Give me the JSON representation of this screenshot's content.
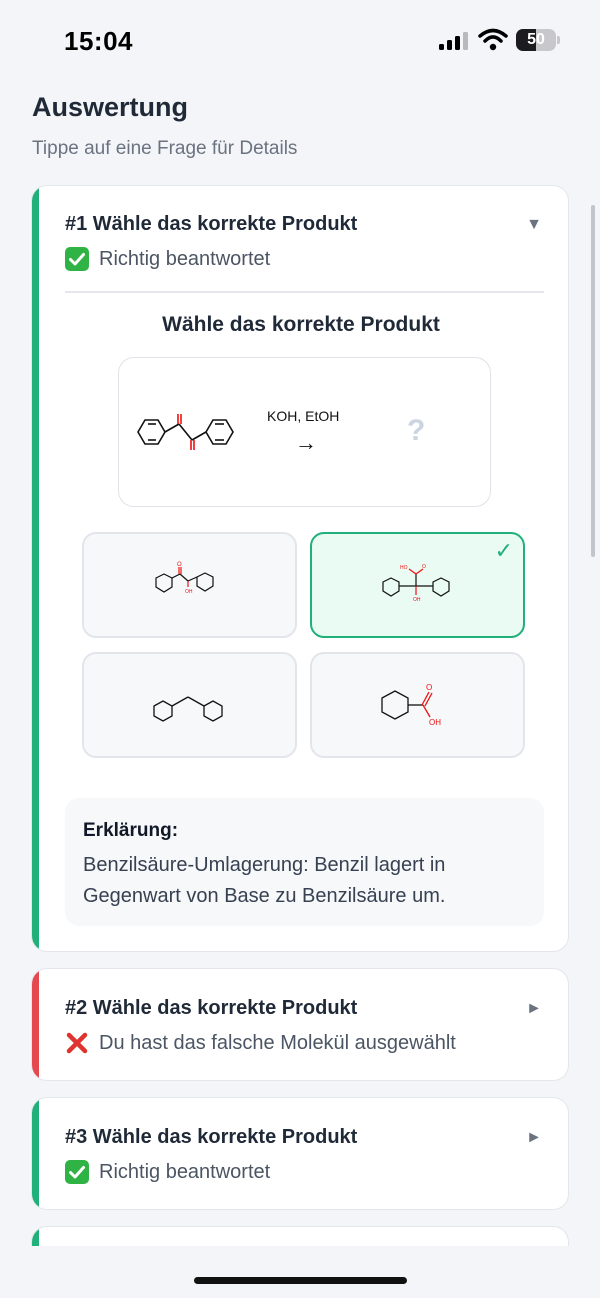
{
  "status_bar": {
    "time": "15:04",
    "battery": "50",
    "battery_level": 0.5
  },
  "header": {
    "title": "Auswertung",
    "subtitle": "Tippe auf eine Frage für Details"
  },
  "colors": {
    "correct": "#20b07a",
    "wrong": "#e5484d"
  },
  "questions": [
    {
      "title": "#1 Wähle das korrekte Produkt",
      "status": "Richtig beantwortet",
      "status_icon": "check-mark-icon",
      "toggle": "▼",
      "expanded": true,
      "detail": {
        "heading": "Wähle das korrekte Produkt",
        "reagent": "KOH, EtOH",
        "arrow": "→",
        "unknown": "?",
        "options": [
          {
            "molecule": "benzoin-like",
            "labels": [
              "O",
              "OH"
            ],
            "selected_correct": false
          },
          {
            "molecule": "benzilic-acid",
            "labels": [
              "HO",
              "O",
              "OH"
            ],
            "selected_correct": true
          },
          {
            "molecule": "diphenylmethane",
            "labels": [],
            "selected_correct": false
          },
          {
            "molecule": "benzoic-acid",
            "labels": [
              "O",
              "OH"
            ],
            "selected_correct": false
          }
        ],
        "explanation_label": "Erklärung:",
        "explanation": "Benzilsäure-Umlagerung: Benzil lagert in Gegenwart von Base zu Benzilsäure um."
      }
    },
    {
      "title": "#2 Wähle das korrekte Produkt",
      "status": "Du hast das falsche Molekül ausgewählt",
      "status_icon": "cross-mark-icon",
      "toggle": "►",
      "expanded": false
    },
    {
      "title": "#3 Wähle das korrekte Produkt",
      "status": "Richtig beantwortet",
      "status_icon": "check-mark-icon",
      "toggle": "►",
      "expanded": false
    }
  ]
}
